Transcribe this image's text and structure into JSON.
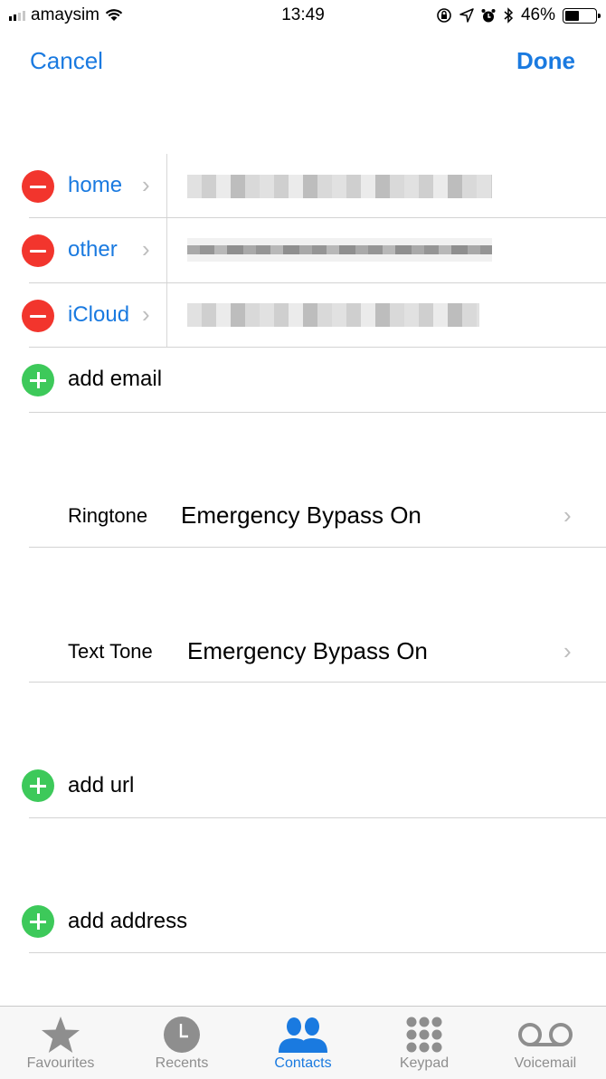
{
  "status_bar": {
    "carrier": "amaysim",
    "time": "13:49",
    "battery_percent": "46%",
    "battery_level": 0.46,
    "icons": [
      "signal-icon",
      "wifi-icon",
      "orientation-lock-icon",
      "location-icon",
      "alarm-icon",
      "bluetooth-icon",
      "battery-icon"
    ]
  },
  "nav": {
    "cancel_label": "Cancel",
    "done_label": "Done"
  },
  "emails": [
    {
      "label": "home",
      "value": "(redacted)"
    },
    {
      "label": "other",
      "value": "(redacted)"
    },
    {
      "label": "iCloud",
      "value": "(redacted)"
    }
  ],
  "add_email_label": "add email",
  "ringtone": {
    "label": "Ringtone",
    "value": "Emergency Bypass On"
  },
  "text_tone": {
    "label": "Text Tone",
    "value": "Emergency Bypass On"
  },
  "add_url_label": "add url",
  "add_address_label": "add address",
  "tabbar": {
    "tabs": [
      {
        "label": "Favourites",
        "icon": "star-icon"
      },
      {
        "label": "Recents",
        "icon": "clock-icon"
      },
      {
        "label": "Contacts",
        "icon": "contacts-icon",
        "active": true
      },
      {
        "label": "Keypad",
        "icon": "keypad-icon"
      },
      {
        "label": "Voicemail",
        "icon": "voicemail-icon"
      }
    ]
  },
  "colors": {
    "accent": "#1a7ae0",
    "delete": "#f2352d",
    "add": "#3dc95a"
  }
}
